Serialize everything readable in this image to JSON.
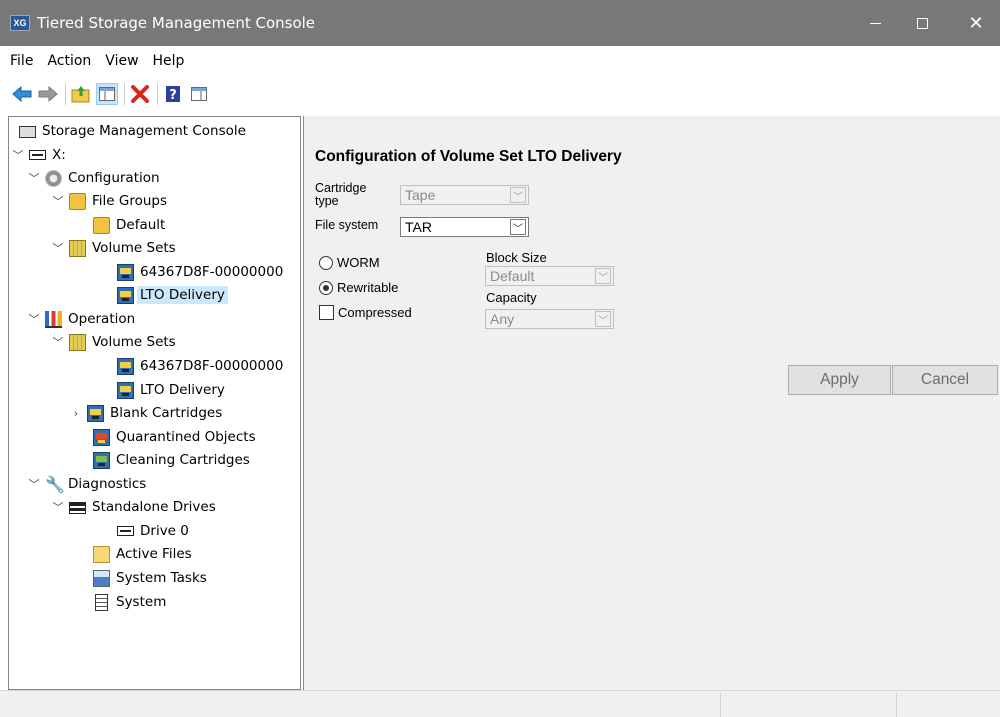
{
  "window": {
    "title": "Tiered Storage Management Console",
    "app_icon_text": "XG"
  },
  "menu": [
    "File",
    "Action",
    "View",
    "Help"
  ],
  "toolbar": [
    "back-icon",
    "forward-icon",
    "up-folder-icon",
    "show-hide-tree-icon",
    "delete-icon",
    "help-icon",
    "properties-icon"
  ],
  "tree": {
    "root": "Storage Management Console",
    "drive": "X:",
    "configuration": "Configuration",
    "file_groups": "File Groups",
    "default": "Default",
    "volume_sets": "Volume Sets",
    "vs1": "64367D8F-00000000",
    "lto": "LTO Delivery",
    "operation": "Operation",
    "op_volume_sets": "Volume Sets",
    "op_vs1": "64367D8F-00000000",
    "op_lto": "LTO Delivery",
    "blank_cartridges": "Blank Cartridges",
    "quarantined": "Quarantined Objects",
    "cleaning": "Cleaning Cartridges",
    "diagnostics": "Diagnostics",
    "standalone_drives": "Standalone Drives",
    "drive0": "Drive 0",
    "active_files": "Active Files",
    "system_tasks": "System Tasks",
    "system": "System"
  },
  "config": {
    "title": "Configuration of Volume Set LTO Delivery",
    "cartridge_type_label": "Cartridge type",
    "cartridge_type_value": "Tape",
    "file_system_label": "File system",
    "file_system_value": "TAR",
    "worm_label": "WORM",
    "rewritable_label": "Rewritable",
    "compressed_label": "Compressed",
    "block_size_label": "Block Size",
    "block_size_value": "Default",
    "capacity_label": "Capacity",
    "capacity_value": "Any",
    "apply_label": "Apply",
    "cancel_label": "Cancel"
  }
}
